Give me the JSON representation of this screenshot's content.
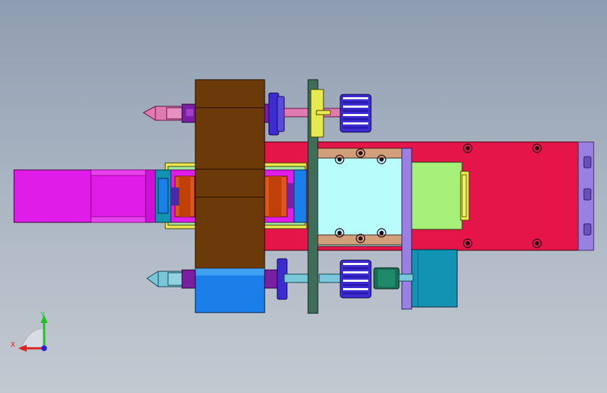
{
  "viewport": {
    "background_top": "#8f9db0",
    "background_bottom": "#c3c9d1"
  },
  "colors": {
    "magenta_motor": "#e01ce8",
    "red_base": "#e5154a",
    "brown_block": "#6b3a08",
    "blue_block": "#1a7fe8",
    "cyan_carriage": "#b8fdfb",
    "light_green": "#a6f07a",
    "lavender_plate": "#9a80e0",
    "teal_motor": "#1393b3",
    "dark_green_plate": "#3f6e58",
    "yellow": "#e8e850",
    "tan_rail": "#d1a07a",
    "pink_nozzle": "#e07ab0",
    "lightblue_nozzle": "#7ac7d9",
    "purple_collar": "#7b1fa2",
    "indigo_pulley": "#3b2bd0",
    "orange_roller": "#e0551a"
  },
  "icons": {
    "screw": "hex-socket-screw-icon",
    "pulley": "timing-pulley-icon",
    "triad": "xyz-axis-triad-icon"
  },
  "triad": {
    "x_label": "X",
    "y_label": "Y",
    "x_color": "#e02020",
    "y_color": "#20c020",
    "z_color": "#2020e0"
  }
}
